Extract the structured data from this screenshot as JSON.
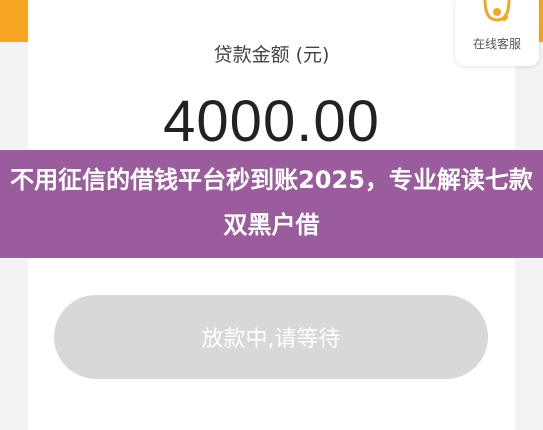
{
  "loan": {
    "amount_label": "贷款金额 (元)",
    "amount_value": "4000.00"
  },
  "customer_service": {
    "label": "在线客服",
    "icon": "headset-icon",
    "color": "#f6a623"
  },
  "overlay": {
    "title": "不用征信的借钱平台秒到账2025，专业解读七款双黑户借"
  },
  "action": {
    "button_label": "放款中,请等待"
  },
  "colors": {
    "accent": "#f6a623",
    "overlay": "#9b5c9d",
    "button": "#d8d8d8"
  }
}
